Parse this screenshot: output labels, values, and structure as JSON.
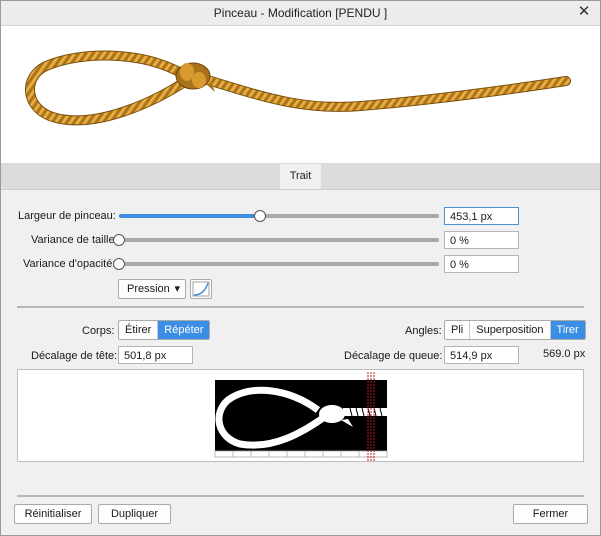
{
  "window": {
    "title": "Pinceau - Modification [PENDU ]",
    "close_glyph": "✕"
  },
  "tabs": [
    {
      "label": "Trait"
    }
  ],
  "stroke": {
    "width": {
      "label": "Largeur de pinceau:",
      "value": "453,1 px",
      "level": 0.44
    },
    "size_variance": {
      "label": "Variance de taille:",
      "value": "0 %",
      "level": 0.0
    },
    "opacity_variance": {
      "label": "Variance d'opacité:",
      "value": "0 %",
      "level": 0.0
    },
    "pressure": {
      "label": "Pression",
      "arrow": "▾"
    }
  },
  "body": {
    "label": "Corps:",
    "options": [
      {
        "label": "Étirer",
        "selected": false
      },
      {
        "label": "Répéter",
        "selected": true
      }
    ]
  },
  "angles": {
    "label": "Angles:",
    "options": [
      {
        "label": "Pli",
        "selected": false
      },
      {
        "label": "Superposition",
        "selected": false
      },
      {
        "label": "Tirer",
        "selected": true
      }
    ]
  },
  "head_offset": {
    "label": "Décalage de tête:",
    "value": "501,8 px"
  },
  "tail_offset": {
    "label": "Décalage de queue:",
    "value": "514,9 px"
  },
  "total_width": "569.0 px",
  "buttons": {
    "reset": "Réinitialiser",
    "duplicate": "Dupliquer",
    "close": "Fermer"
  },
  "colors": {
    "accent": "#3a8ee6",
    "rope": "#d49a2a",
    "rope_dark": "#8a5a10",
    "marker": "#c01818"
  },
  "icons": {
    "close": "close-icon",
    "pressure_curve": "pressure-curve-icon"
  }
}
